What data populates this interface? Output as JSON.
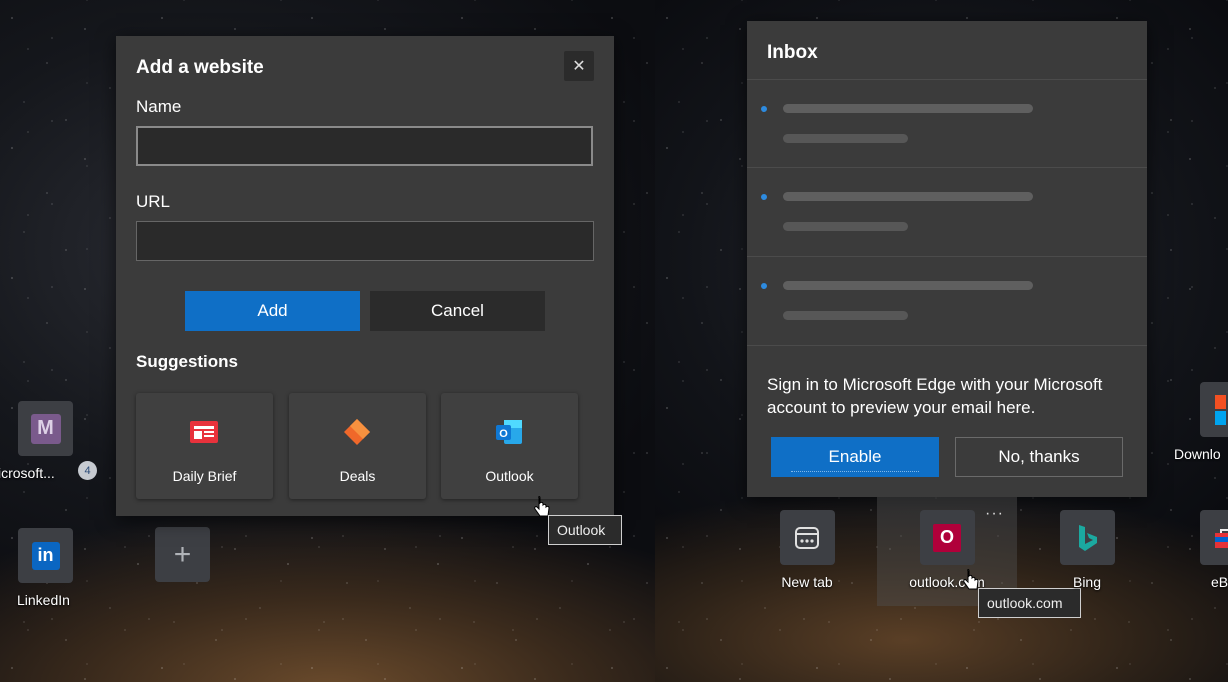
{
  "dialog": {
    "title": "Add a website",
    "close_glyph": "✕",
    "name_label": "Name",
    "name_value": "",
    "url_label": "URL",
    "url_value": "",
    "add_label": "Add",
    "cancel_label": "Cancel",
    "suggestions_title": "Suggestions",
    "suggestions": [
      {
        "label": "Daily Brief",
        "icon": "news-icon",
        "color": "#e8323c"
      },
      {
        "label": "Deals",
        "icon": "tag-icon",
        "color": "#f0682a"
      },
      {
        "label": "Outlook",
        "icon": "outlook-icon",
        "color": "#0f78d4"
      }
    ],
    "tooltip": "Outlook"
  },
  "inbox": {
    "title": "Inbox",
    "message": "Sign in to Microsoft Edge with your Microsoft account to preview your email here.",
    "enable_label": "Enable",
    "no_thanks_label": "No, thanks",
    "accent": "#0f6fc6"
  },
  "tiles": {
    "microsoft": {
      "label": "icrosoft...",
      "letter": "M",
      "badge": "4"
    },
    "linkedin": {
      "label": "LinkedIn",
      "letter": "in"
    },
    "newtab": {
      "label": "New tab"
    },
    "outlook": {
      "label": "outlook.com",
      "letter": "O",
      "more": "···"
    },
    "bing": {
      "label": "Bing"
    },
    "downloads": {
      "label": "Downlo"
    },
    "ebay": {
      "label": "eB"
    },
    "outlook_tooltip": "outlook.com"
  }
}
